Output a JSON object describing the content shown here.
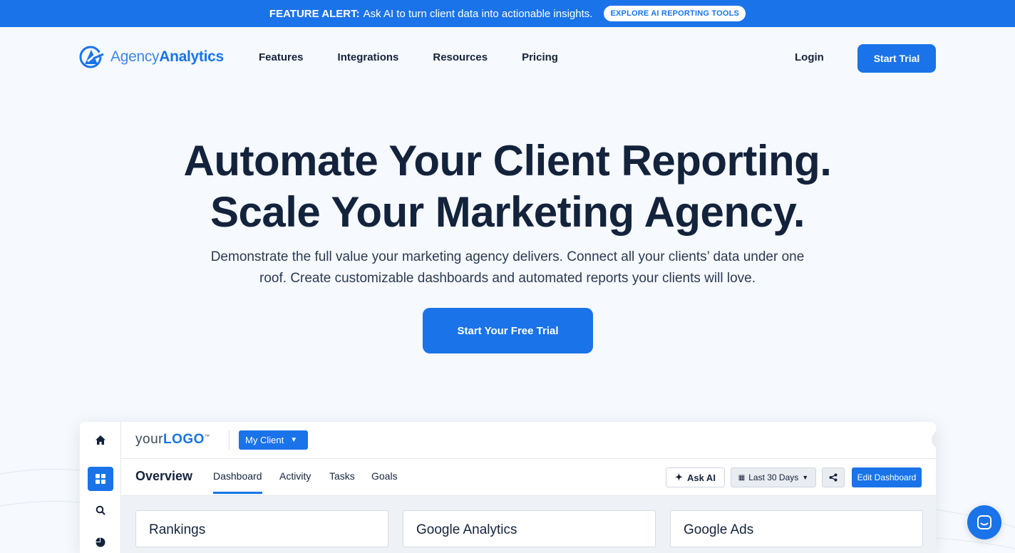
{
  "alert": {
    "label": "FEATURE ALERT:",
    "text": "Ask AI to turn client data into actionable insights.",
    "button": "EXPLORE AI REPORTING TOOLS"
  },
  "nav": {
    "logo_light": "Agency",
    "logo_bold": "Analytics",
    "links": [
      "Features",
      "Integrations",
      "Resources",
      "Pricing"
    ],
    "login": "Login",
    "start_trial": "Start Trial"
  },
  "hero": {
    "title_line1": "Automate Your Client Reporting.",
    "title_line2": "Scale Your Marketing Agency.",
    "subtitle": "Demonstrate the full value your marketing agency delivers. Connect all your clients’ data under one roof. Create customizable dashboards and automated reports your clients will love.",
    "cta": "Start Your Free Trial"
  },
  "dashboard": {
    "logo_your": "your",
    "logo_logo": "LOGO",
    "logo_tm": "™",
    "client_select": "My Client",
    "help": "?",
    "title": "Overview",
    "tabs": [
      "Dashboard",
      "Activity",
      "Tasks",
      "Goals"
    ],
    "active_tab": "Dashboard",
    "ask_ai": "Ask AI",
    "date_range": "Last 30 Days",
    "edit": "Edit Dashboard",
    "cards": [
      "Rankings",
      "Google Analytics",
      "Google Ads"
    ],
    "side_icons": [
      "home-icon",
      "grid-icon",
      "search-icon",
      "pie-chart-icon"
    ]
  },
  "colors": {
    "primary": "#1a73e8",
    "text_dark": "#14233c",
    "page_bg": "#f6f9fd"
  }
}
